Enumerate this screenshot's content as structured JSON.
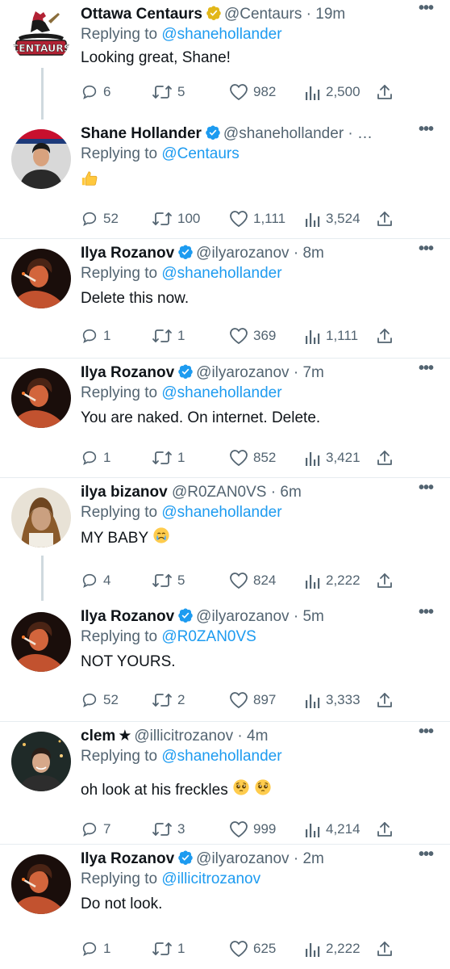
{
  "tweets": [
    {
      "name": "Ottawa Centaurs",
      "badge": "gold",
      "handle": "@Centaurs",
      "dot": " · ",
      "time": "19m",
      "replying_prefix": "Replying to ",
      "replying_to": "@shanehollander",
      "text": "Looking great, Shane!",
      "replies": "6",
      "retweets": "5",
      "likes": "982",
      "views": "2,500",
      "avatar": "centaurs-logo"
    },
    {
      "name": "Shane Hollander",
      "badge": "blue",
      "handle": "@shanehollander",
      "dot": " · ",
      "time": "…",
      "replying_prefix": "Replying to ",
      "replying_to": "@Centaurs",
      "text": "",
      "emoji": "thumbs-up",
      "replies": "52",
      "retweets": "100",
      "likes": "1,111",
      "views": "3,524",
      "avatar": "shane"
    },
    {
      "name": "Ilya Rozanov",
      "badge": "blue",
      "handle": "@ilyarozanov",
      "dot": " · ",
      "time": "8m",
      "replying_prefix": "Replying to ",
      "replying_to": "@shanehollander",
      "text": "Delete this now.",
      "replies": "1",
      "retweets": "1",
      "likes": "369",
      "views": "1,111",
      "avatar": "ilya"
    },
    {
      "name": "Ilya Rozanov",
      "badge": "blue",
      "handle": "@ilyarozanov",
      "dot": " · ",
      "time": "7m",
      "replying_prefix": "Replying to ",
      "replying_to": "@shanehollander",
      "text": "You are naked. On internet. Delete.",
      "replies": "1",
      "retweets": "1",
      "likes": "852",
      "views": "3,421",
      "avatar": "ilya"
    },
    {
      "name": "ilya bizanov",
      "badge": "",
      "handle": "@R0ZAN0VS",
      "dot": " · ",
      "time": "6m",
      "replying_prefix": "Replying to ",
      "replying_to": "@shanehollander",
      "text": "MY BABY ",
      "emoji": "crying-face",
      "replies": "4",
      "retweets": "5",
      "likes": "824",
      "views": "2,222",
      "avatar": "bizanov"
    },
    {
      "name": "Ilya Rozanov",
      "badge": "blue",
      "handle": "@ilyarozanov",
      "dot": " · ",
      "time": "5m",
      "replying_prefix": "Replying to ",
      "replying_to": "@R0ZAN0VS",
      "text": "NOT YOURS.",
      "replies": "52",
      "retweets": "2",
      "likes": "897",
      "views": "3,333",
      "avatar": "ilya"
    },
    {
      "name": "clem",
      "badge": "star",
      "handle": "@illicitrozanov",
      "dot": " · ",
      "time": "4m",
      "replying_prefix": "Replying to ",
      "replying_to": "@shanehollander",
      "text": "oh look at his freckles ",
      "emoji": "pleading-face-x2",
      "replies": "7",
      "retweets": "3",
      "likes": "999",
      "views": "4,214",
      "avatar": "clem"
    },
    {
      "name": "Ilya Rozanov",
      "badge": "blue",
      "handle": "@ilyarozanov",
      "dot": " · ",
      "time": "2m",
      "replying_prefix": "Replying to ",
      "replying_to": "@illicitrozanov",
      "text": "Do not look.",
      "replies": "1",
      "retweets": "1",
      "likes": "625",
      "views": "2,222",
      "avatar": "ilya"
    }
  ],
  "icons": {
    "reply": "reply-icon",
    "retweet": "retweet-icon",
    "like": "heart-icon",
    "views": "views-icon",
    "share": "share-icon",
    "more": "more-icon"
  },
  "colors": {
    "link": "#1d9bf0",
    "muted": "#536471",
    "verified_blue": "#1d9bf0",
    "verified_gold": "#e2b719",
    "crying_face": "#ffcc4d"
  },
  "centaurs_logo_text": "CENTAURS",
  "more_glyph": "•••",
  "star_glyph": "★"
}
